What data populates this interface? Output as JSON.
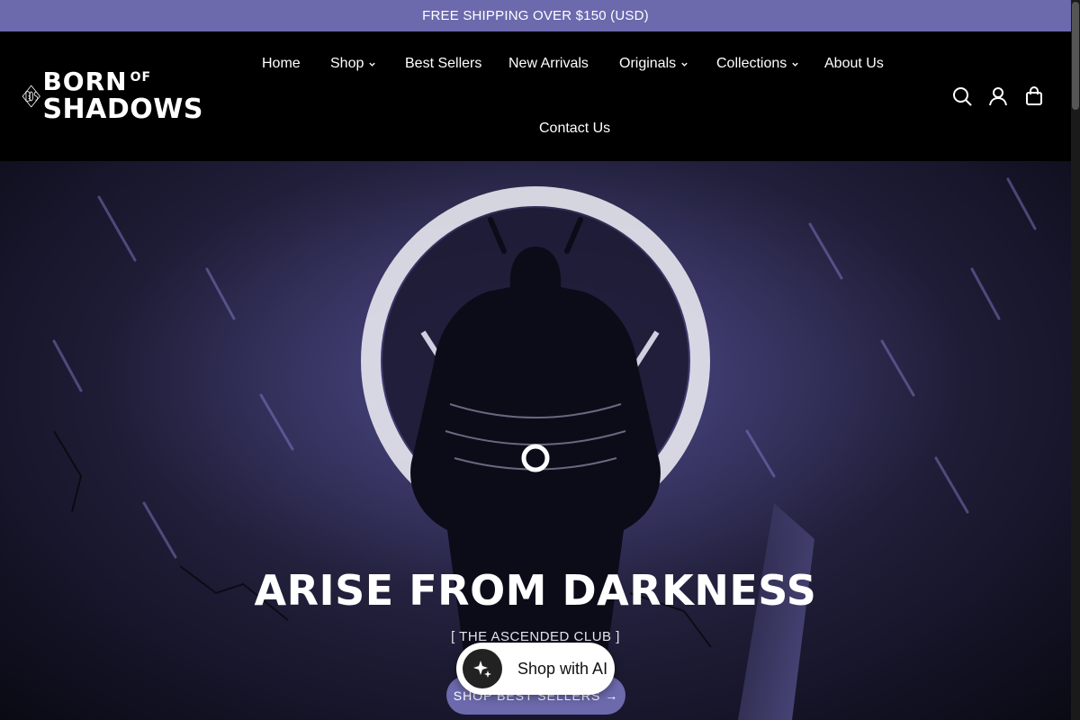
{
  "announcement": "FREE SHIPPING OVER $150 (USD)",
  "brand": {
    "top": "BORN",
    "of": "OF",
    "bottom": "SHADOWS"
  },
  "nav": {
    "home": "Home",
    "shop": "Shop",
    "best_sellers": "Best Sellers",
    "new_arrivals": "New Arrivals",
    "originals": "Originals",
    "collections": "Collections",
    "about": "About Us",
    "contact": "Contact Us"
  },
  "icons": [
    "search-icon",
    "account-icon",
    "cart-icon",
    "chevron-down-icon",
    "sparkle-icon"
  ],
  "hero": {
    "title": "ARISE FROM DARKNESS",
    "subtitle": "[ THE ASCENDED CLUB ]",
    "cta": "SHOP BEST SELLERS →"
  },
  "shop_ai": {
    "label": "Shop with AI"
  },
  "colors": {
    "accent": "#6d69ad",
    "header_bg": "#000000",
    "hero_bg": "#24223f"
  }
}
